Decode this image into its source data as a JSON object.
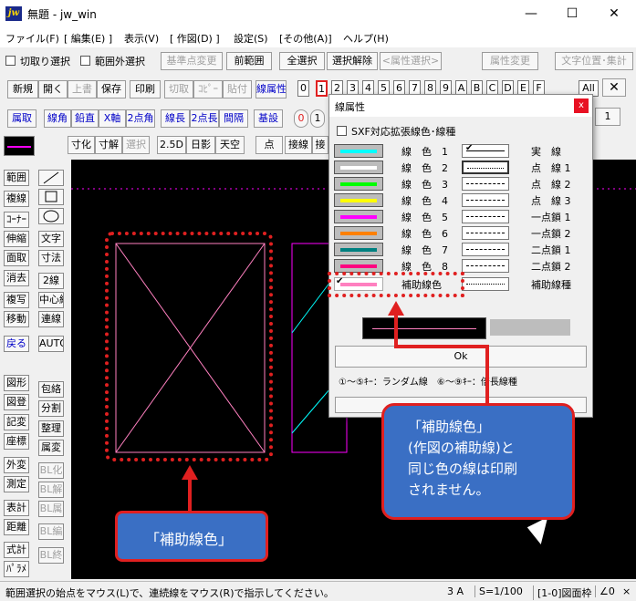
{
  "window": {
    "title": "無題 - jw_win",
    "app_icon": "jw",
    "minimize": "—",
    "maximize": "☐",
    "close": "✕"
  },
  "menu": [
    "ファイル(F)",
    "[ 編集(E) ]",
    "表示(V)",
    "[ 作図(D) ]",
    "設定(S)",
    "[その他(A)]",
    "ヘルプ(H)"
  ],
  "toolbar1": {
    "cut_select": "切取り選択",
    "out_select": "範囲外選択",
    "base_point": "基準点変更",
    "prev_range": "前範囲",
    "select_all": "全選択",
    "deselect": "選択解除",
    "attr_select": "<属性選択>",
    "attr_change": "属性変更",
    "text_pos": "文字位置･集計"
  },
  "toolbar2": {
    "new": "新規",
    "open": "開く",
    "overwrite": "上書",
    "save": "保存",
    "print": "印刷",
    "cut": "切取",
    "copy": "ｺﾋﾟｰ",
    "paste": "貼付",
    "line_attr": "線属性",
    "layers": [
      "0",
      "1",
      "2",
      "3",
      "4",
      "5",
      "6",
      "7",
      "8",
      "9",
      "A",
      "B",
      "C",
      "D",
      "E",
      "F"
    ],
    "all": "All"
  },
  "toolbar3": {
    "attr_get": "属取",
    "line_angle": "線角",
    "vertical": "鉛直",
    "x_axis": "X軸",
    "two_point": "2点角",
    "line_length": "線長",
    "two_point_len": "2点長",
    "interval": "間隔",
    "base": "基設",
    "marks": [
      "0",
      "1"
    ],
    "right_value": "1"
  },
  "toolbar4": {
    "dimension": "寸化",
    "dim_solve": "寸解",
    "reselect": "選択",
    "view25": "2.5D",
    "sun_shadow": "日影",
    "sky": "天空",
    "point": "点",
    "tangent": "接線",
    "contact": "接"
  },
  "left_tools": {
    "col1": [
      "範囲",
      "複線",
      "ｺｰﾅｰ",
      "伸縮",
      "面取",
      "消去",
      "複写",
      "移動",
      "戻る"
    ],
    "col2": [
      "文字",
      "寸法",
      "2線",
      "中心線",
      "連線",
      "AUTO"
    ],
    "col1b": [
      "図形",
      "図登",
      "記変",
      "座標",
      "外変",
      "測定",
      "表計",
      "距離",
      "式計",
      "ﾊﾟﾗﾒ"
    ],
    "col2b": [
      "包絡",
      "分割",
      "整理",
      "属変",
      "BL化",
      "BL解",
      "BL属",
      "BL編",
      "BL終"
    ]
  },
  "dialog": {
    "title": "線属性",
    "close": "x",
    "sxf_label": "SXF対応拡張線色･線種",
    "colors": [
      {
        "label": "線　色　1",
        "hex": "#00ffff"
      },
      {
        "label": "線　色　2",
        "hex": "#ffffff"
      },
      {
        "label": "線　色　3",
        "hex": "#00ff00"
      },
      {
        "label": "線　色　4",
        "hex": "#ffff00"
      },
      {
        "label": "線　色　5",
        "hex": "#ff00ff"
      },
      {
        "label": "線　色　6",
        "hex": "#ff8000"
      },
      {
        "label": "線　色　7",
        "hex": "#008080"
      },
      {
        "label": "線　色　8",
        "hex": "#ff0080"
      },
      {
        "label": "補助線色",
        "hex": "#ff80c0"
      }
    ],
    "line_types": [
      "実　線",
      "点　線 1",
      "点　線 2",
      "点　線 3",
      "一点鎖 1",
      "一点鎖 2",
      "二点鎖 1",
      "二点鎖 2",
      "補助線種"
    ],
    "check": "✔",
    "ok": "Ok",
    "hint": "①～⑤ｷｰ：ランダム線　⑥～⑨ｷｰ：倍長線種"
  },
  "callouts": {
    "bottom": "「補助線色」",
    "right": "「補助線色」\n(作図の補助線)と\n同じ色の線は印刷\nされません。"
  },
  "status": {
    "message": "範囲選択の始点をマウス(L)で、連続線をマウス(R)で指示してください。",
    "size": "3 A",
    "scale": "S=1/100",
    "layer": "[1-0]図面枠",
    "zoom": "∠0",
    "extra": "×"
  }
}
